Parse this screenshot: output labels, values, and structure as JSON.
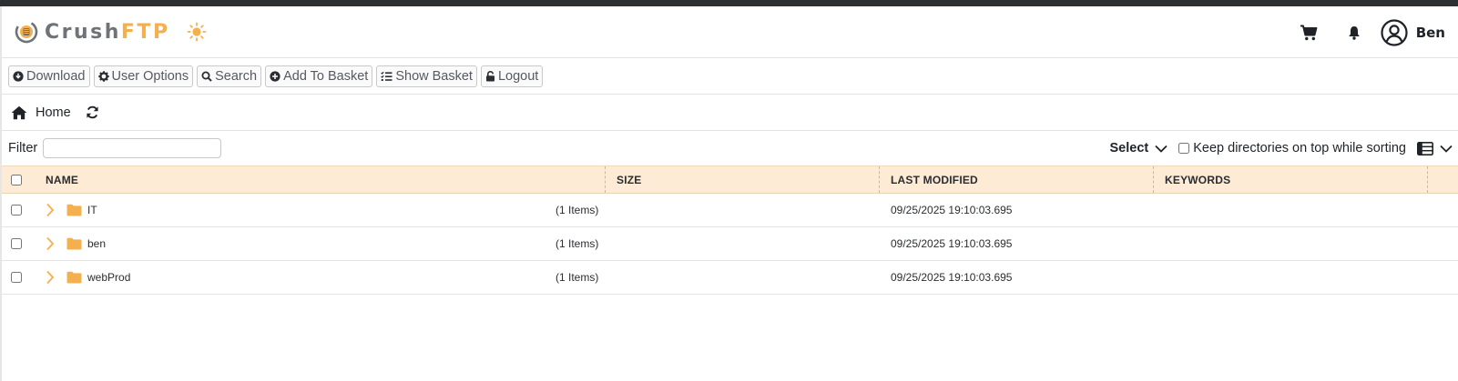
{
  "app": {
    "logo_text_a": "Crush",
    "logo_text_b": "FTP",
    "theme_icon": "sun-icon",
    "user_name": "Ben",
    "brand_color": "#f4b04f"
  },
  "toolbar": {
    "buttons": [
      {
        "label": "Download",
        "icon": "download-circle-icon"
      },
      {
        "label": "User Options",
        "icon": "gear-icon"
      },
      {
        "label": "Search",
        "icon": "search-icon"
      },
      {
        "label": "Add To Basket",
        "icon": "plus-circle-icon"
      },
      {
        "label": "Show Basket",
        "icon": "list-check-icon"
      },
      {
        "label": "Logout",
        "icon": "unlock-icon"
      }
    ]
  },
  "breadcrumb": {
    "home_label": "Home"
  },
  "filter": {
    "label": "Filter",
    "value": "",
    "placeholder": "",
    "select_label": "Select",
    "keep_dirs_label": "Keep directories on top while sorting",
    "keep_dirs_checked": false
  },
  "table": {
    "columns": {
      "name": "NAME",
      "size": "SIZE",
      "modified": "LAST MODIFIED",
      "keywords": "KEYWORDS"
    },
    "header_bg": "#fdebd6",
    "rows": [
      {
        "name": "IT",
        "items": "(1 Items)",
        "modified": "09/25/2025 19:10:03.695",
        "keywords": ""
      },
      {
        "name": "ben",
        "items": "(1 Items)",
        "modified": "09/25/2025 19:10:03.695",
        "keywords": ""
      },
      {
        "name": "webProd",
        "items": "(1 Items)",
        "modified": "09/25/2025 19:10:03.695",
        "keywords": ""
      }
    ]
  }
}
